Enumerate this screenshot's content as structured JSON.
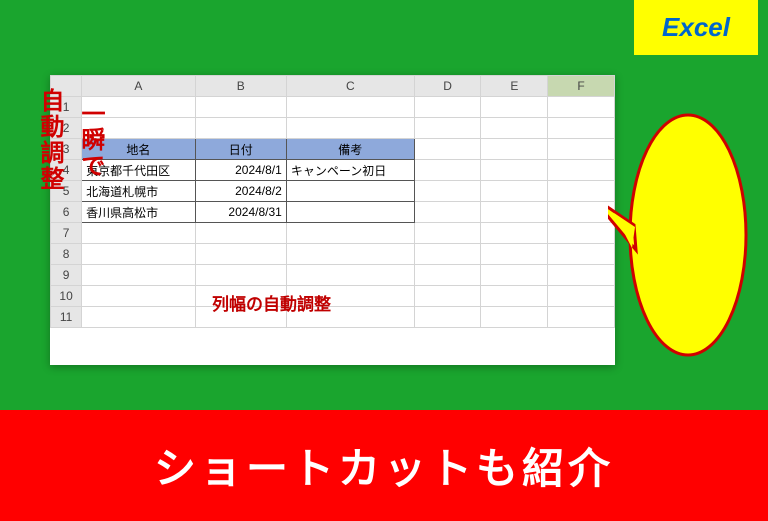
{
  "badge": {
    "label": "Excel"
  },
  "bubble": {
    "line1": "一瞬で",
    "line2": "自動調整"
  },
  "sheet": {
    "columns": [
      "A",
      "B",
      "C",
      "D",
      "E",
      "F"
    ],
    "selected_col": "F",
    "rows": [
      "1",
      "2",
      "3",
      "4",
      "5",
      "6",
      "7",
      "8",
      "9",
      "10",
      "11"
    ],
    "headers": {
      "c1": "地名",
      "c2": "日付",
      "c3": "備考"
    },
    "data": [
      {
        "c1": "東京都千代田区",
        "c2": "2024/8/1",
        "c3": "キャンペーン初日"
      },
      {
        "c1": "北海道札幌市",
        "c2": "2024/8/2",
        "c3": ""
      },
      {
        "c1": "香川県高松市",
        "c2": "2024/8/31",
        "c3": ""
      }
    ]
  },
  "annotation": "列幅の自動調整",
  "banner": "ショートカットも紹介"
}
